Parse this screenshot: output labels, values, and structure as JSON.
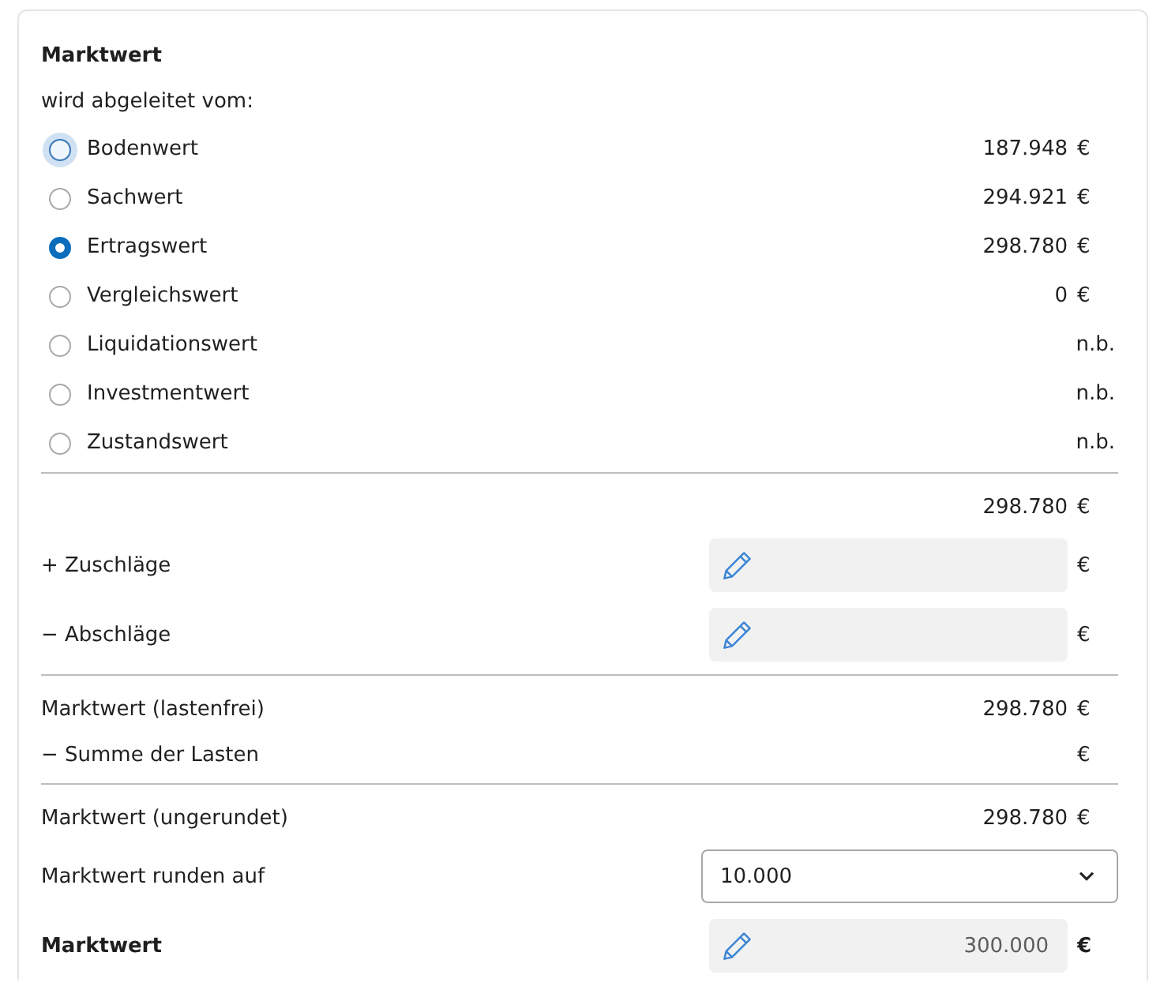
{
  "section": {
    "title": "Marktwert",
    "subtitle": "wird abgeleitet vom:"
  },
  "options": [
    {
      "label": "Bodenwert",
      "value": "187.948",
      "unit": "€",
      "selected": false,
      "focused": true
    },
    {
      "label": "Sachwert",
      "value": "294.921",
      "unit": "€",
      "selected": false,
      "focused": false
    },
    {
      "label": "Ertragswert",
      "value": "298.780",
      "unit": "€",
      "selected": true,
      "focused": false
    },
    {
      "label": "Vergleichswert",
      "value": "0",
      "unit": "€",
      "selected": false,
      "focused": false
    },
    {
      "label": "Liquidationswert",
      "value": "n.b.",
      "selected": false,
      "focused": false
    },
    {
      "label": "Investmentwert",
      "value": "n.b.",
      "selected": false,
      "focused": false
    },
    {
      "label": "Zustandswert",
      "value": "n.b.",
      "selected": false,
      "focused": false
    }
  ],
  "rows": [
    {
      "kind": "divider"
    },
    {
      "kind": "amount",
      "value": "298.780",
      "unit": "€"
    },
    {
      "kind": "input",
      "label": "+ Zuschläge",
      "unit": "€"
    },
    {
      "kind": "input",
      "label": "− Abschläge",
      "unit": "€"
    },
    {
      "kind": "divider"
    },
    {
      "kind": "amount",
      "label": "Marktwert (lastenfrei)",
      "value": "298.780",
      "unit": "€"
    },
    {
      "kind": "amount",
      "label": "− Summe der Lasten",
      "unit": "€"
    },
    {
      "kind": "divider"
    },
    {
      "kind": "amount",
      "label": "Marktwert (ungerundet)",
      "value": "298.780",
      "unit": "€"
    },
    {
      "kind": "select",
      "label": "Marktwert runden auf",
      "value": "10.000"
    },
    {
      "kind": "input",
      "label": "Marktwert",
      "value": "300.000",
      "unit": "€",
      "bold": true
    }
  ]
}
